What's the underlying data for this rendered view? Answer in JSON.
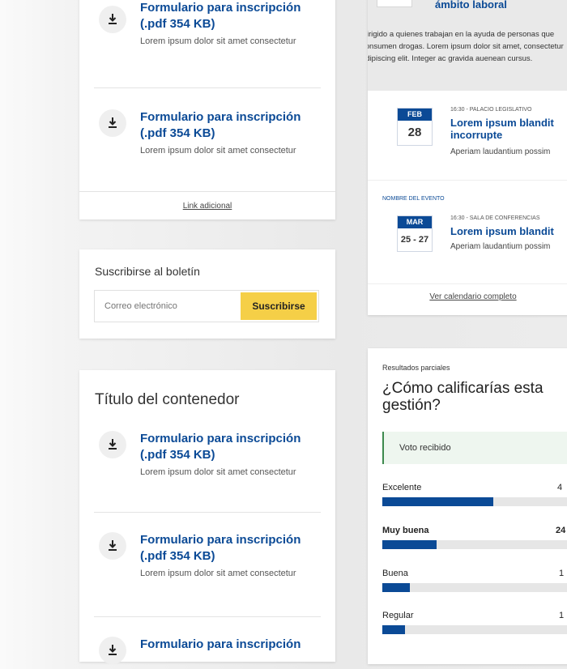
{
  "downloads_top": {
    "items": [
      {
        "title": "Formulario para inscripción (.pdf 354 KB)",
        "desc": "Lorem ipsum dolor sit amet consectetur"
      },
      {
        "title": "Formulario para inscripción (.pdf 354 KB)",
        "desc": "Lorem ipsum dolor sit amet consectetur"
      }
    ],
    "link": "Link adicional"
  },
  "newsletter": {
    "title": "Suscribirse al boletín",
    "placeholder": "Correo electrónico",
    "button": "Suscribirse"
  },
  "container": {
    "title": "Título del contenedor",
    "items": [
      {
        "title": "Formulario para inscripción (.pdf 354 KB)",
        "desc": "Lorem ipsum dolor sit amet consectetur"
      },
      {
        "title": "Formulario para inscripción (.pdf 354 KB)",
        "desc": "Lorem ipsum dolor sit amet consectetur"
      },
      {
        "title": "Formulario para inscripción",
        "desc": ""
      }
    ]
  },
  "events": {
    "featured_title": "ámbito laboral",
    "featured_text": "Dirigido a quienes trabajan en la ayuda de personas que consumen drogas. Lorem ipsum dolor sit amet, consectetur adipiscing elit. Integer ac gravida auenean cursus.",
    "list": [
      {
        "category": "",
        "month": "FEB",
        "day": "28",
        "meta": "16:30 - PALACIO LEGISLATIVO",
        "title_line1": "Lorem ipsum blandit",
        "title_line2": "incorrupte",
        "desc": "Aperiam laudantium possim"
      },
      {
        "category": "NOMBRE DEL EVENTO",
        "month": "MAR",
        "day": "25 - 27",
        "meta": "16:30 - SALA DE CONFERENCIAS",
        "title_line1": "Lorem ipsum blandit",
        "title_line2": "",
        "desc": "Aperiam laudantium possim"
      }
    ],
    "calendar_link": "Ver calendario completo"
  },
  "poll": {
    "label": "Resultados parciales",
    "question": "¿Cómo calificarías esta gestión?",
    "vote_msg": "Voto recibido",
    "options": [
      {
        "label": "Excelente",
        "pct_text": "4",
        "fraction": 0.49
      },
      {
        "label": "Muy buena",
        "pct_text": "24",
        "fraction": 0.24
      },
      {
        "label": "Buena",
        "pct_text": "1",
        "fraction": 0.12
      },
      {
        "label": "Regular",
        "pct_text": "1",
        "fraction": 0.1
      }
    ],
    "colors": {
      "accent": "#0b4a96",
      "bar_bg": "#e6e6e6",
      "vote_border": "#3d8a4e",
      "vote_bg": "#eef6ef"
    }
  }
}
